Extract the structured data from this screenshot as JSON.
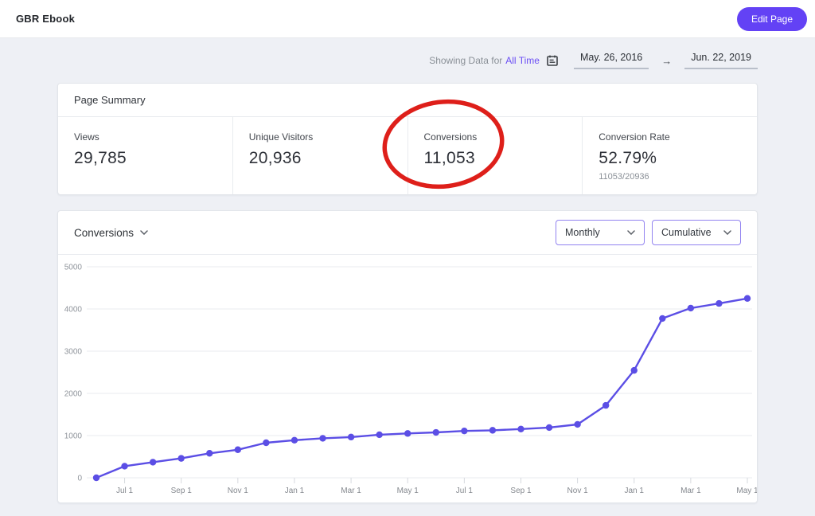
{
  "header": {
    "title": "GBR Ebook",
    "edit_button_label": "Edit Page"
  },
  "filter_bar": {
    "showing_label": "Showing Data for",
    "range_label": "All Time",
    "start_date": "May. 26, 2016",
    "arrow": "→",
    "end_date": "Jun. 22, 2019"
  },
  "summary": {
    "title": "Page Summary",
    "metrics": [
      {
        "label": "Views",
        "value": "29,785"
      },
      {
        "label": "Unique Visitors",
        "value": "20,936"
      },
      {
        "label": "Conversions",
        "value": "11,053",
        "annotated": "red-circle"
      },
      {
        "label": "Conversion Rate",
        "value": "52.79%",
        "sub": "11053/20936"
      }
    ]
  },
  "chart_card": {
    "metric_selector": "Conversions",
    "interval_selector": "Monthly",
    "mode_selector": "Cumulative"
  },
  "chart_data": {
    "type": "line",
    "title": "Conversions",
    "mode": "Cumulative",
    "interval": "Monthly",
    "series": [
      {
        "name": "Conversions (cumulative)",
        "values": [
          0,
          275,
          370,
          460,
          580,
          665,
          830,
          890,
          935,
          965,
          1020,
          1050,
          1075,
          1110,
          1125,
          1155,
          1190,
          1265,
          1715,
          2545,
          3775,
          4020,
          4130,
          4250
        ]
      }
    ],
    "x_tick_labels": [
      "Jul 1",
      "Sep 1",
      "Nov 1",
      "Jan 1",
      "Mar 1",
      "May 1",
      "Jul 1",
      "Sep 1",
      "Nov 1",
      "Jan 1",
      "Mar 1",
      "May 1"
    ],
    "x_tick_indices": [
      1,
      3,
      5,
      7,
      9,
      11,
      13,
      15,
      17,
      19,
      21,
      23
    ],
    "y_ticks": [
      0,
      1000,
      2000,
      3000,
      4000,
      5000
    ],
    "ylim": [
      0,
      5000
    ],
    "grid": "horizontal",
    "legend": "none",
    "line_color": "#5b4ee5"
  },
  "colors": {
    "accent_purple": "#6342f5",
    "link_purple": "#6b4ef5",
    "select_border_purple": "#9283f0",
    "chart_line": "#5b4ee5",
    "annotation_red": "#de1f1a",
    "page_background": "#eef0f5"
  }
}
